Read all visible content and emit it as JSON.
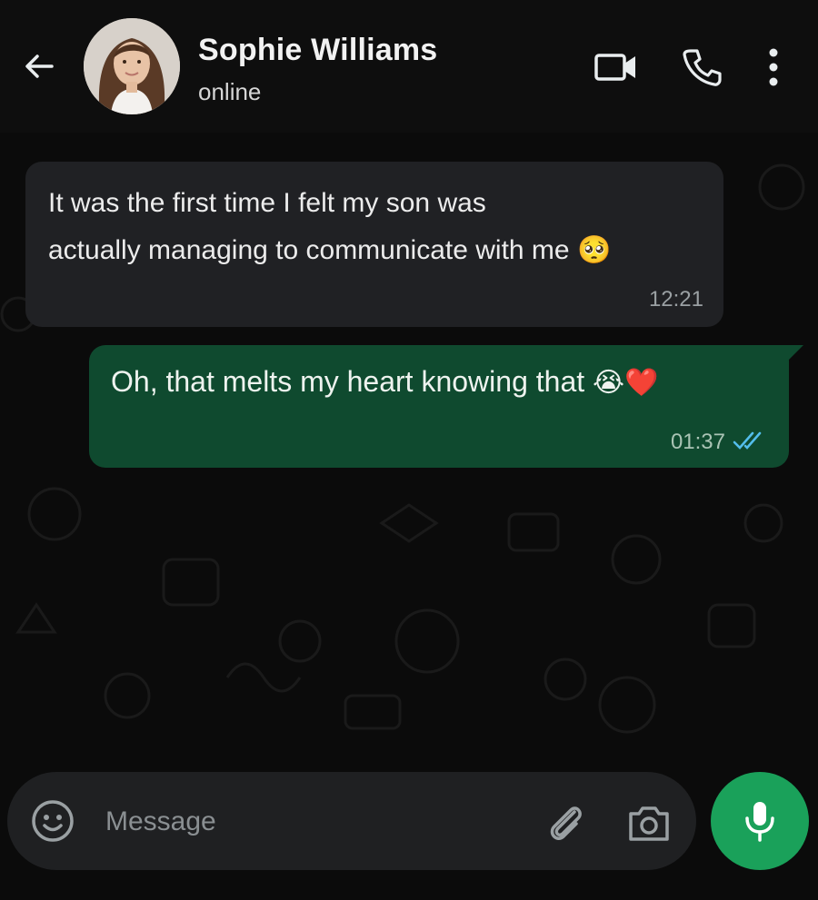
{
  "header": {
    "contact_name": "Sophie Williams",
    "status": "online",
    "icons": [
      "back-arrow-icon",
      "video-call-icon",
      "phone-icon",
      "more-options-icon"
    ]
  },
  "messages": [
    {
      "direction": "incoming",
      "line1": "It was the first time I felt my son was",
      "line2": "actually managing to communicate with me",
      "emoji": "🥺",
      "time": "12:21"
    },
    {
      "direction": "outgoing",
      "text": "Oh, that melts my heart knowing that",
      "emoji": "😭❤️",
      "time": "01:37",
      "status": "read"
    }
  ],
  "composer": {
    "placeholder": "Message",
    "value": "",
    "icons": [
      "emoji-icon",
      "attach-icon",
      "camera-icon",
      "mic-icon"
    ]
  },
  "colors": {
    "accent": "#1aa15a",
    "outgoing_bubble": "#0f4a2f",
    "incoming_bubble": "#202124",
    "read_ticks": "#53bdeb"
  }
}
